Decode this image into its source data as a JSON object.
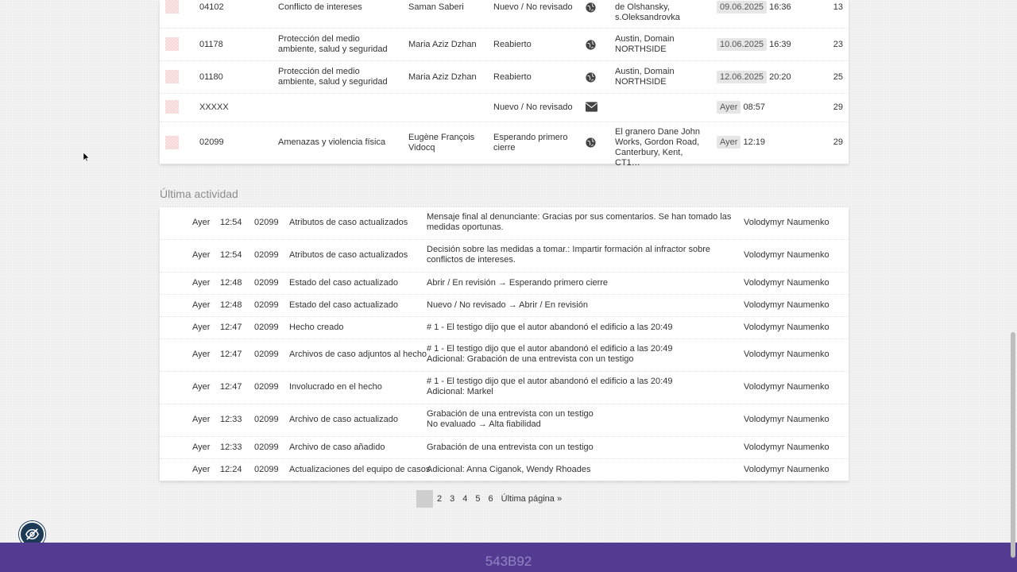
{
  "cases": [
    {
      "id": "04102",
      "category": "Conflicto de intereses",
      "reporter": "Saman Saberi",
      "status": "Nuevo / No revisado",
      "channel": "globe-icon",
      "location": "de Olshansky, s.Oleksandrovka",
      "date": "09.06.2025",
      "time": "16:36",
      "count": "13"
    },
    {
      "id": "01178",
      "category": "Protección del medio ambiente, salud y seguridad",
      "reporter": "Maria Aziz Dzhan",
      "status": "Reabierto",
      "channel": "globe-icon",
      "location": "Austin, Domain NORTHSIDE",
      "date": "10.06.2025",
      "time": "16:39",
      "count": "23"
    },
    {
      "id": "01180",
      "category": "Protección del medio ambiente, salud y seguridad",
      "reporter": "Maria Aziz Dzhan",
      "status": "Reabierto",
      "channel": "globe-icon",
      "location": "Austin, Domain NORTHSIDE",
      "date": "12.06.2025",
      "time": "20:20",
      "count": "25"
    },
    {
      "id": "XXXXX",
      "category": "",
      "reporter": "",
      "status": "Nuevo / No revisado",
      "channel": "envelope-icon",
      "location": "",
      "date": "Ayer",
      "time": "08:57",
      "count": "29"
    },
    {
      "id": "02099",
      "category": "Amenazas y violencia física",
      "reporter": "Eugène François Vidocq",
      "status": "Esperando primero cierre",
      "channel": "globe-icon",
      "location": "El granero Dane John Works, Gordon Road, Canterbury, Kent, CT1…",
      "date": "Ayer",
      "time": "12:19",
      "count": "29"
    }
  ],
  "activity": {
    "title": "Última actividad",
    "rows": [
      {
        "day": "Ayer",
        "time": "12:54",
        "case": "02099",
        "event": "Atributos de caso actualizados",
        "detail": "Mensaje final al denunciante: Gracias por sus comentarios. Se han tomado las medidas oportunas.",
        "user": "Volodymyr Naumenko"
      },
      {
        "day": "Ayer",
        "time": "12:54",
        "case": "02099",
        "event": "Atributos de caso actualizados",
        "detail": "Decisión sobre las medidas a tomar.: Impartir formación al infractor sobre conflictos de intereses.",
        "user": "Volodymyr Naumenko"
      },
      {
        "day": "Ayer",
        "time": "12:48",
        "case": "02099",
        "event": "Estado del caso actualizado",
        "detail": "Abrir / En revisión → Esperando primero cierre",
        "user": "Volodymyr Naumenko"
      },
      {
        "day": "Ayer",
        "time": "12:48",
        "case": "02099",
        "event": "Estado del caso actualizado",
        "detail": "Nuevo / No revisado → Abrir / En revisión",
        "user": "Volodymyr Naumenko"
      },
      {
        "day": "Ayer",
        "time": "12:47",
        "case": "02099",
        "event": "Hecho creado",
        "detail": "# 1 - El testigo dijo que el autor abandonó el edificio a las 20:49",
        "user": "Volodymyr Naumenko"
      },
      {
        "day": "Ayer",
        "time": "12:47",
        "case": "02099",
        "event": "Archivos de caso adjuntos al hecho",
        "detail": "# 1 - El testigo dijo que el autor abandonó el edificio a las 20:49\nAdicional: Grabación de una entrevista con un testigo",
        "user": "Volodymyr Naumenko"
      },
      {
        "day": "Ayer",
        "time": "12:47",
        "case": "02099",
        "event": "Involucrado en el hecho",
        "detail": "# 1 - El testigo dijo que el autor abandonó el edificio a las 20:49\nAdicional: Markel",
        "user": "Volodymyr Naumenko"
      },
      {
        "day": "Ayer",
        "time": "12:33",
        "case": "02099",
        "event": "Archivo de caso actualizado",
        "detail": "Grabación de una entrevista con un testigo\nNo evaluado → Alta fiabilidad",
        "user": "Volodymyr Naumenko"
      },
      {
        "day": "Ayer",
        "time": "12:33",
        "case": "02099",
        "event": "Archivo de caso añadido",
        "detail": "Grabación de una entrevista con un testigo",
        "user": "Volodymyr Naumenko"
      },
      {
        "day": "Ayer",
        "time": "12:24",
        "case": "02099",
        "event": "Actualizaciones del equipo de casos",
        "detail": "Adicional: Anna Ciganok, Wendy Rhoades",
        "user": "Volodymyr Naumenko"
      }
    ]
  },
  "pagination": {
    "current": "1",
    "pages": [
      "2",
      "3",
      "4",
      "5",
      "6"
    ],
    "last_label": "Última página »"
  },
  "footer": {
    "text": "543B92"
  },
  "colors": {
    "footer_bg": "#543b92",
    "badge_bg": "#e6e6e6",
    "flag": "#f6d6d6"
  }
}
